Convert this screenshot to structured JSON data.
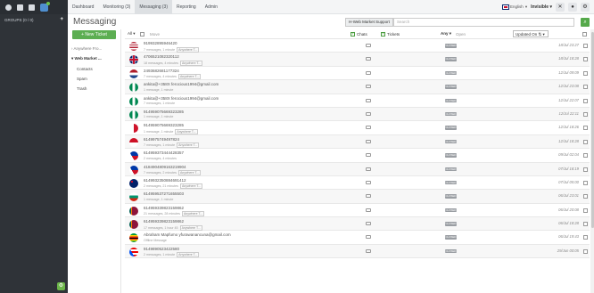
{
  "leftbar": {
    "groups_label": "GROUPS (0 / 0)"
  },
  "nav": {
    "items": [
      "Dashboard",
      "Monitoring (3)",
      "Messaging (3)",
      "Reporting",
      "Admin"
    ],
    "language": "English",
    "status": "Invisible"
  },
  "page": {
    "title": "Messaging",
    "filter_value": "H-Web Market Support",
    "search_placeholder": "Search"
  },
  "folders": {
    "new_ticket": "+ New Ticket",
    "items": [
      {
        "label": "Anywhere Fro...",
        "bold": false
      },
      {
        "label": "Web Market ...",
        "bold": true
      }
    ],
    "subitems": [
      "Contacts",
      "Spam",
      "Trash"
    ]
  },
  "list_header": {
    "all": "All",
    "move": "Move",
    "chats": "Chats",
    "tickets": "Tickets",
    "any": "Any",
    "open": "Open",
    "sort": "Updated On"
  },
  "rows": [
    {
      "flag": "us",
      "title": "919932895946420",
      "sub": "7 messages, 1 minute",
      "tag": "Anywhere T...",
      "status": "CLOSED",
      "date": "18/Jul 23:27"
    },
    {
      "flag": "uk",
      "title": "4706521082320112",
      "sub": "18 messages, 4 minutes",
      "tag": "Anywhere T...",
      "status": "CLOSED",
      "date": "18/Jul 18:28"
    },
    {
      "flag": "nl",
      "title": "2493682681177324",
      "sub": "7 messages, 4 minutes",
      "tag": "Anywhere T...",
      "status": "CLOSED",
      "date": "12/Jul 09:09"
    },
    {
      "flag": "ng",
      "title": "ankita@+358X ferocious1994@gmail.com",
      "sub": "1 message, 1 minute",
      "tag": "",
      "status": "CLOSED",
      "date": "12/Jul 23:08"
    },
    {
      "flag": "ng",
      "title": "ankita@+358X ferocious1994@gmail.com",
      "sub": "7 messages, 1 minute",
      "tag": "",
      "status": "CLOSED",
      "date": "12/Jul 22:07"
    },
    {
      "flag": "ng",
      "title": "914959075669323285",
      "sub": "1 message, 1 minute",
      "tag": "",
      "status": "CLOSED",
      "date": "12/Jul 22:11"
    },
    {
      "flag": "mt",
      "title": "914959075669323285",
      "sub": "1 message, 1 minute",
      "tag": "Anywhere T...",
      "status": "CLOSED",
      "date": "12/Jul 18:26"
    },
    {
      "flag": "id",
      "title": "6149975749497824",
      "sub": "7 messages, 1 minute",
      "tag": "Anywhere T...",
      "status": "CLOSED",
      "date": "12/Jul 18:28"
    },
    {
      "flag": "ph",
      "title": "614959373444428357",
      "sub": "2 messages, 4 minutes",
      "tag": "",
      "status": "CLOSED",
      "date": "09/Jul 02:04"
    },
    {
      "flag": "ph",
      "title": "4184904809163219904",
      "sub": "7 messages, 2 minutes",
      "tag": "Anywhere T...",
      "status": "CLOSED",
      "date": "07/Jul 18:19"
    },
    {
      "flag": "au",
      "title": "6149932350884691412",
      "sub": "2 messages, 21 minutes",
      "tag": "Anywhere T...",
      "status": "CLOSED",
      "date": "07/Jul 05:00"
    },
    {
      "flag": "bg",
      "title": "614959537271655503",
      "sub": "1 message, 1 minute",
      "tag": "",
      "status": "CLOSED",
      "date": "06/Jul 23:01"
    },
    {
      "flag": "lk",
      "title": "614959339823159862",
      "sub": "21 messages, 28 minutes",
      "tag": "Anywhere T...",
      "status": "CLOSED",
      "date": "06/Jul 20:08"
    },
    {
      "flag": "lk",
      "title": "614959339823159862",
      "sub": "17 messages, 1 hour 45",
      "tag": "Anywhere T...",
      "status": "CLOSED",
      "date": "06/Jul 18:28"
    },
    {
      "flag": "zw",
      "title": "Abraham Mapfumo yfurawanancuna@gmail.com",
      "sub": "Offline Message",
      "tag": "",
      "status": "CLOSED",
      "date": "06/Jul 19:43"
    },
    {
      "flag": "pr",
      "title": "9149890523422580",
      "sub": "2 messages, 1 minute",
      "tag": "Anywhere T...",
      "status": "CLOSED",
      "date": "29/Jun 00:05"
    }
  ]
}
